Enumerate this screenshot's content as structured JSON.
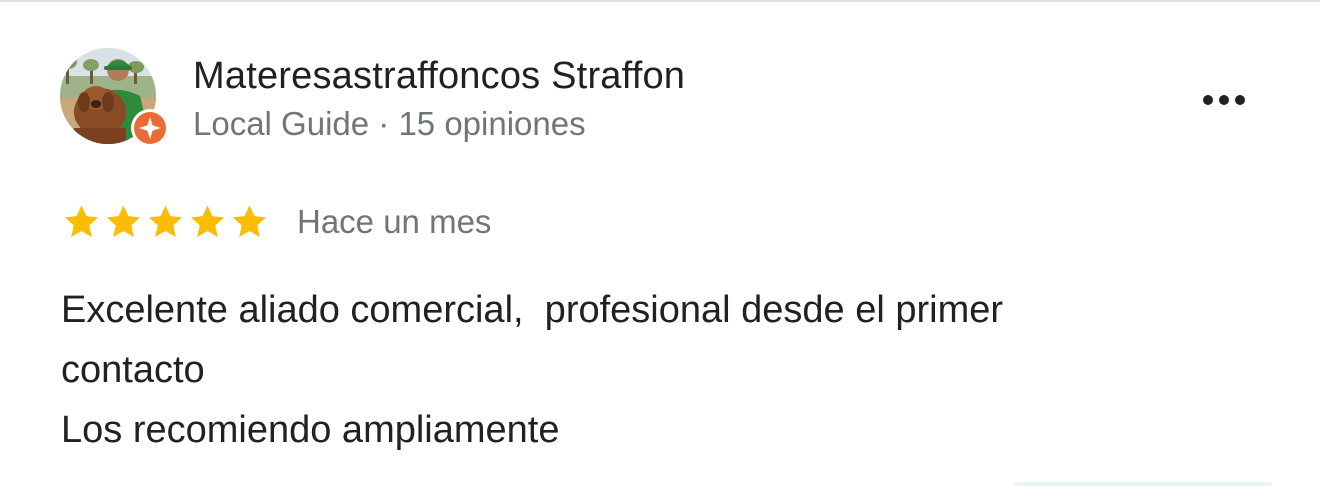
{
  "reviewer": {
    "name": "Materesastraffoncos Straffon",
    "meta": "Local Guide · 15 opiniones",
    "avatar_icon": "person-with-dog-photo",
    "badge_icon": "local-guide-star-badge",
    "badge_color": "#ea6b35"
  },
  "menu": {
    "icon": "more-horizontal-icon"
  },
  "review": {
    "rating": 5,
    "rating_max": 5,
    "star_color": "#fbbc04",
    "time": "Hace un mes",
    "text_lines": [
      "Excelente aliado comercial,  profesional desde el primer",
      "contacto",
      "Los recomiendo ampliamente"
    ]
  }
}
